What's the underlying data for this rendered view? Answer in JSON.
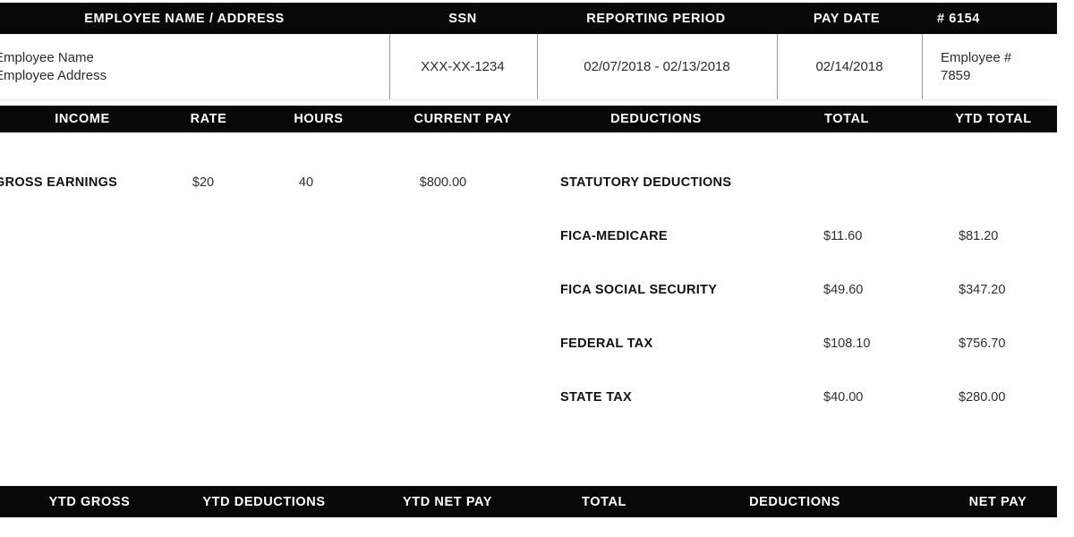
{
  "header": {
    "columns": [
      {
        "label": "EMPLOYEE NAME / ADDRESS",
        "align": "center"
      },
      {
        "label": "SSN",
        "align": "center"
      },
      {
        "label": "REPORTING PERIOD",
        "align": "center"
      },
      {
        "label": "PAY DATE",
        "align": "center"
      },
      {
        "label": "#  6154",
        "align": "left"
      }
    ]
  },
  "employee": {
    "name": "Employee Name",
    "address": "Employee Address",
    "ssn": "XXX-XX-1234",
    "reporting_period": "02/07/2018 - 02/13/2018",
    "pay_date": "02/14/2018",
    "employee_number_label": "Employee #",
    "employee_number": "7859",
    "check_number": "#  6154"
  },
  "income": {
    "columns": [
      "INCOME",
      "RATE",
      "HOURS",
      "CURRENT PAY"
    ],
    "rows": [
      {
        "name": "GROSS EARNINGS",
        "rate": "$20",
        "hours": "40",
        "current_pay": "$800.00"
      }
    ]
  },
  "deductions": {
    "columns": [
      "DEDUCTIONS",
      "TOTAL",
      "YTD TOTAL"
    ],
    "section_title": "STATUTORY DEDUCTIONS",
    "rows": [
      {
        "name": "FICA-MEDICARE",
        "total": "$11.60",
        "ytd_total": "$81.20"
      },
      {
        "name": "FICA SOCIAL SECURITY",
        "total": "$49.60",
        "ytd_total": "$347.20"
      },
      {
        "name": "FEDERAL TAX",
        "total": "$108.10",
        "ytd_total": "$756.70"
      },
      {
        "name": "STATE TAX",
        "total": "$40.00",
        "ytd_total": "$280.00"
      }
    ]
  },
  "footer": {
    "columns": [
      "YTD GROSS",
      "YTD DEDUCTIONS",
      "YTD NET PAY",
      "TOTAL",
      "DEDUCTIONS",
      "NET PAY"
    ]
  },
  "colors": {
    "bar_background": "#080808",
    "bar_text": "#ffffff",
    "page_background": "#ffffff",
    "body_text": "#2e2e2e",
    "divider": "#b4b4b4"
  }
}
